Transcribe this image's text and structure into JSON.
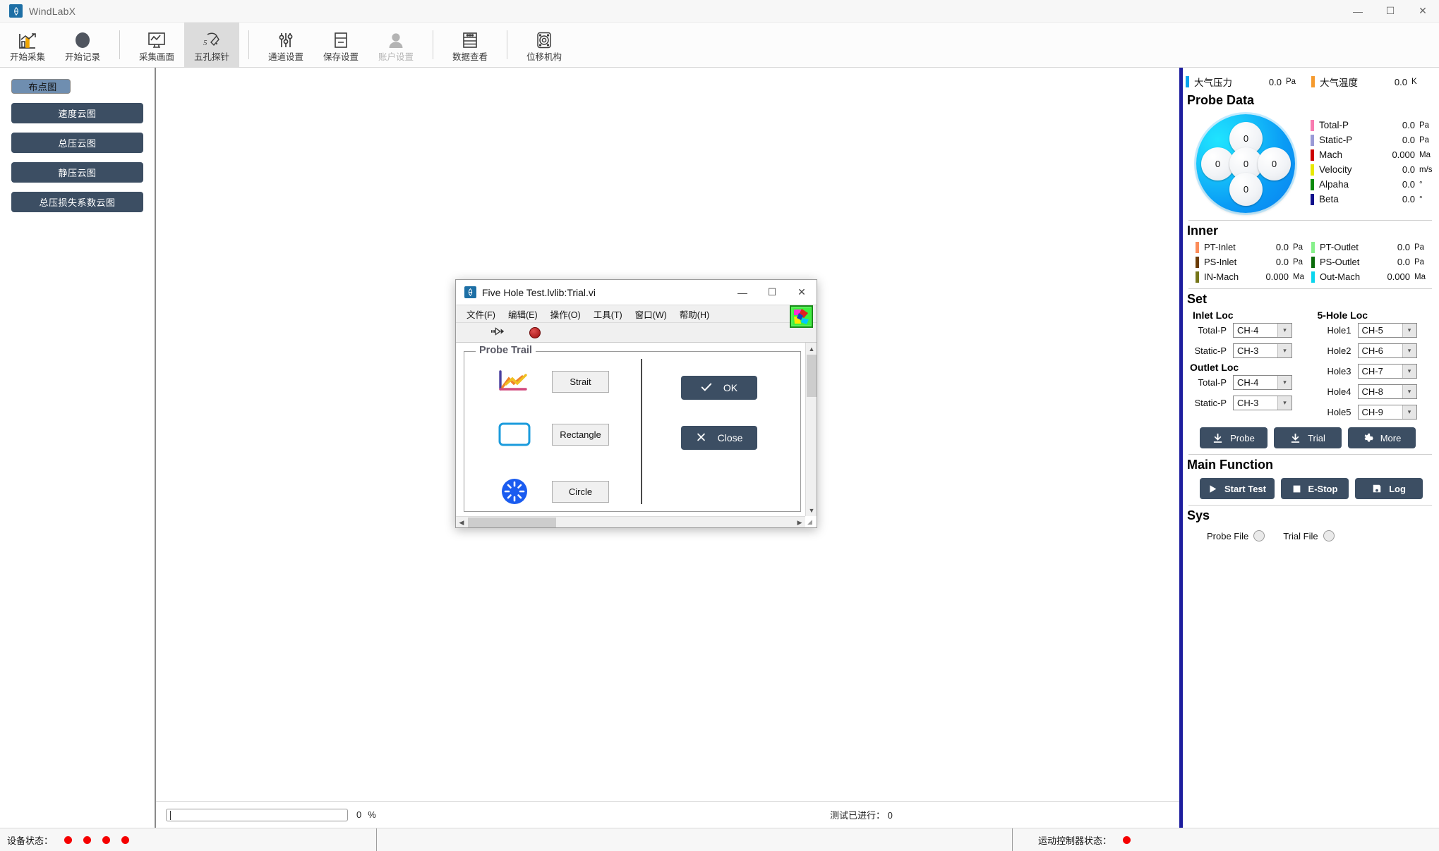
{
  "window": {
    "app_title": "WindLabX",
    "logo_icon": "windlab-logo-icon",
    "minimize": "—",
    "maximize": "☐",
    "close": "✕"
  },
  "ribbon": {
    "items": [
      {
        "label": "开始采集",
        "icon": "bar-chart-arrow-icon",
        "state": "normal"
      },
      {
        "label": "开始记录",
        "icon": "record-ellipse-icon",
        "state": "normal"
      },
      {
        "label": "采集画面",
        "icon": "monitor-waveform-icon",
        "state": "normal"
      },
      {
        "label": "五孔探针",
        "icon": "five-hole-probe-icon",
        "state": "active"
      },
      {
        "label": "通道设置",
        "icon": "sliders-icon",
        "state": "normal"
      },
      {
        "label": "保存设置",
        "icon": "save-disk-icon",
        "state": "normal"
      },
      {
        "label": "账户设置",
        "icon": "user-icon",
        "state": "disabled"
      },
      {
        "label": "数据查看",
        "icon": "data-table-icon",
        "state": "normal"
      },
      {
        "label": "位移机构",
        "icon": "motion-stage-icon",
        "state": "normal"
      }
    ]
  },
  "sidebar": {
    "items": [
      {
        "label": "布点图",
        "selected": true
      },
      {
        "label": "速度云图",
        "selected": false
      },
      {
        "label": "总压云图",
        "selected": false
      },
      {
        "label": "静压云图",
        "selected": false
      },
      {
        "label": "总压损失系数云图",
        "selected": false
      }
    ]
  },
  "status_bar": {
    "progress_value": "0",
    "progress_unit": "%",
    "test_count_label": "测试已进行：  0"
  },
  "device_bar": {
    "device_status_label": "设备状态：",
    "device_leds": 4,
    "motion_status_label": "运动控制器状态：",
    "motion_leds": 1,
    "led_color": "#f50000"
  },
  "right_panel": {
    "atmosphere": [
      {
        "label": "大气压力",
        "value": "0.0",
        "unit": "Pa",
        "color": "#0aa2ec"
      },
      {
        "label": "大气温度",
        "value": "0.0",
        "unit": "K",
        "color": "#f59a2e"
      }
    ],
    "probe_data": {
      "title": "Probe Data",
      "rosette": {
        "top": "0",
        "left": "0",
        "center": "0",
        "right": "0",
        "bottom": "0"
      },
      "values": [
        {
          "label": "Total-P",
          "value": "0.0",
          "unit": "Pa",
          "color": "#f87bb0"
        },
        {
          "label": "Static-P",
          "value": "0.0",
          "unit": "Pa",
          "color": "#9a9ad6"
        },
        {
          "label": "Mach",
          "value": "0.000",
          "unit": "Ma",
          "color": "#cc0000"
        },
        {
          "label": "Velocity",
          "value": "0.0",
          "unit": "m/s",
          "color": "#e8e800"
        },
        {
          "label": "Alpaha",
          "value": "0.0",
          "unit": "°",
          "color": "#0a8a0a"
        },
        {
          "label": "Beta",
          "value": "0.0",
          "unit": "°",
          "color": "#10108c"
        }
      ]
    },
    "inner": {
      "title": "Inner",
      "left": [
        {
          "label": "PT-Inlet",
          "value": "0.0",
          "unit": "Pa",
          "color": "#fb8c5a"
        },
        {
          "label": "PS-Inlet",
          "value": "0.0",
          "unit": "Pa",
          "color": "#6b3c06"
        },
        {
          "label": "IN-Mach",
          "value": "0.000",
          "unit": "Ma",
          "color": "#76761a"
        }
      ],
      "right": [
        {
          "label": "PT-Outlet",
          "value": "0.0",
          "unit": "Pa",
          "color": "#86f08a"
        },
        {
          "label": "PS-Outlet",
          "value": "0.0",
          "unit": "Pa",
          "color": "#0a6b0a"
        },
        {
          "label": "Out-Mach",
          "value": "0.000",
          "unit": "Ma",
          "color": "#0ad6ee"
        }
      ]
    },
    "set": {
      "title": "Set",
      "inlet_loc_title": "Inlet Loc",
      "outlet_loc_title": "Outlet Loc",
      "five_hole_title": "5-Hole Loc",
      "inlet": [
        {
          "label": "Total-P",
          "value": "CH-4"
        },
        {
          "label": "Static-P",
          "value": "CH-3"
        }
      ],
      "outlet": [
        {
          "label": "Total-P",
          "value": "CH-4"
        },
        {
          "label": "Static-P",
          "value": "CH-3"
        }
      ],
      "holes": [
        {
          "label": "Hole1",
          "value": "CH-5"
        },
        {
          "label": "Hole2",
          "value": "CH-6"
        },
        {
          "label": "Hole3",
          "value": "CH-7"
        },
        {
          "label": "Hole4",
          "value": "CH-8"
        },
        {
          "label": "Hole5",
          "value": "CH-9"
        }
      ],
      "buttons": [
        {
          "label": "Probe",
          "icon": "download-icon"
        },
        {
          "label": "Trial",
          "icon": "download-icon"
        },
        {
          "label": "More",
          "icon": "gear-icon"
        }
      ]
    },
    "main_function": {
      "title": "Main Function",
      "buttons": [
        {
          "label": "Start Test",
          "icon": "play-icon"
        },
        {
          "label": "E-Stop",
          "icon": "stop-square-icon"
        },
        {
          "label": "Log",
          "icon": "save-disk-icon"
        }
      ]
    },
    "sys": {
      "title": "Sys",
      "items": [
        {
          "label": "Probe File",
          "icon": "led-indicator"
        },
        {
          "label": "Trial File",
          "icon": "led-indicator"
        }
      ]
    }
  },
  "dialog": {
    "title": "Five Hole Test.lvlib:Trial.vi",
    "logo_icon": "labview-logo-icon",
    "minimize": "—",
    "maximize": "☐",
    "close": "✕",
    "menu": [
      "文件(F)",
      "编辑(E)",
      "操作(O)",
      "工具(T)",
      "窗口(W)",
      "帮助(H)"
    ],
    "toolbar": {
      "run_icon": "run-arrow-icon",
      "abort_icon": "abort-stop-icon",
      "badge_icon": "labview-palette-icon"
    },
    "group_label": "Probe Trail",
    "shapes": [
      {
        "label": "Strait",
        "icon": "line-chart-icon"
      },
      {
        "label": "Rectangle",
        "icon": "rectangle-icon"
      },
      {
        "label": "Circle",
        "icon": "circle-spinner-icon"
      }
    ],
    "actions": [
      {
        "label": "OK",
        "icon": "check-icon"
      },
      {
        "label": "Close",
        "icon": "x-icon"
      }
    ]
  }
}
